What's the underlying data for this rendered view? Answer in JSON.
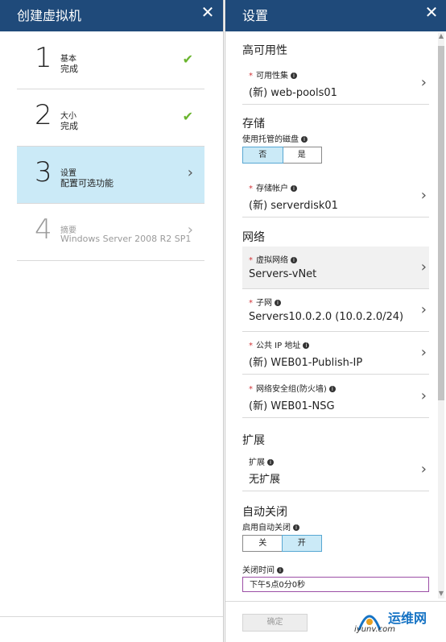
{
  "left_blade": {
    "title": "创建虚拟机",
    "close": "✕",
    "steps": [
      {
        "num": "1",
        "title": "基本",
        "status": "完成",
        "icon": "✔"
      },
      {
        "num": "2",
        "title": "大小",
        "status": "完成",
        "icon": "✔"
      },
      {
        "num": "3",
        "title": "设置",
        "status": "配置可选功能",
        "icon": "›"
      },
      {
        "num": "4",
        "title": "摘要",
        "status": "Windows Server 2008 R2 SP1",
        "icon": "›"
      }
    ]
  },
  "right_blade": {
    "title": "设置",
    "close": "✕",
    "ha": {
      "heading": "高可用性",
      "availability_set": {
        "label": "可用性集",
        "value": "(新) web-pools01"
      }
    },
    "storage": {
      "heading": "存储",
      "managed_disk_label": "使用托管的磁盘",
      "toggle_no": "否",
      "toggle_yes": "是",
      "account": {
        "label": "存储帐户",
        "value": "(新) serverdisk01"
      }
    },
    "network": {
      "heading": "网络",
      "vnet": {
        "label": "虚拟网络",
        "value": "Servers-vNet"
      },
      "subnet": {
        "label": "子网",
        "value": "Servers10.0.2.0 (10.0.2.0/24)"
      },
      "public_ip": {
        "label": "公共 IP 地址",
        "value": "(新) WEB01-Publish-IP"
      },
      "nsg": {
        "label": "网络安全组(防火墙)",
        "value": "(新) WEB01-NSG"
      }
    },
    "extensions": {
      "heading": "扩展",
      "ext": {
        "label": "扩展",
        "value": "无扩展"
      }
    },
    "autoshutdown": {
      "heading": "自动关闭",
      "enable_label": "启用自动关闭",
      "toggle_off": "关",
      "toggle_on": "开",
      "time_label": "关闭时间",
      "time_value": "下午5点0分0秒"
    },
    "ok_label": "确定"
  },
  "watermark": {
    "text": "运维网",
    "url": "iyunv.com"
  },
  "colors": {
    "header": "#1f4a7a",
    "active_step": "#cbeaf7",
    "check": "#6ab52e",
    "required": "#d13438"
  }
}
